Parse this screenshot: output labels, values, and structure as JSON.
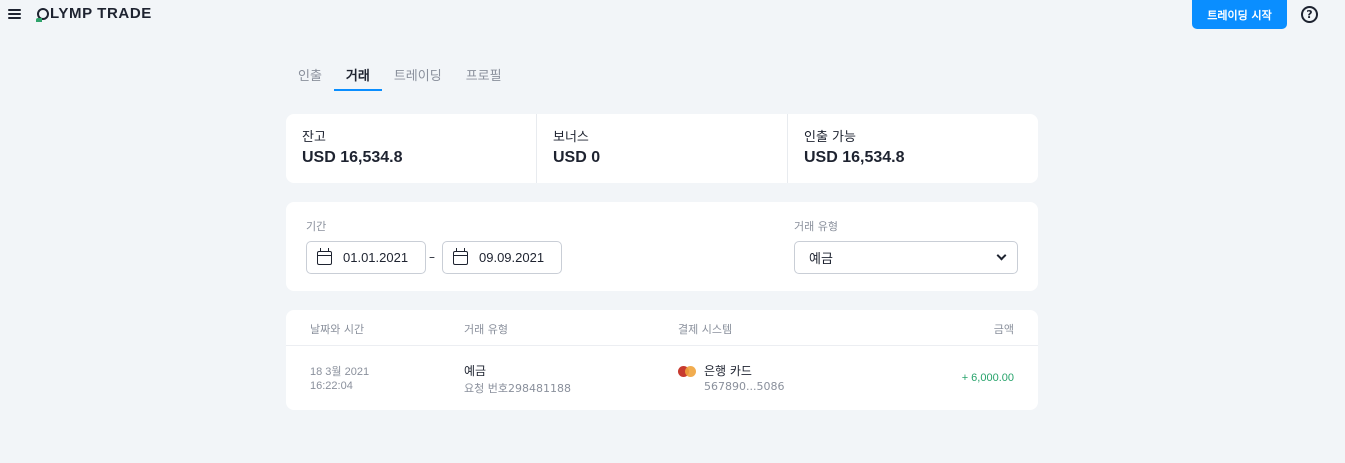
{
  "header": {
    "logo_text": "LYMP TRADE",
    "logo_first_letter": "O",
    "start_button": "트레이딩 시작",
    "help_label": "?"
  },
  "tabs": [
    {
      "label": "인출",
      "active": false
    },
    {
      "label": "거래",
      "active": true
    },
    {
      "label": "트레이딩",
      "active": false
    },
    {
      "label": "프로필",
      "active": false
    }
  ],
  "balances": [
    {
      "label": "잔고",
      "value": "USD 16,534.8"
    },
    {
      "label": "보너스",
      "value": "USD 0"
    },
    {
      "label": "인출 가능",
      "value": "USD 16,534.8"
    }
  ],
  "filters": {
    "period_label": "기간",
    "date_from": "01.01.2021",
    "date_separator": "–",
    "date_to": "09.09.2021",
    "type_label": "거래 유형",
    "type_value": "예금"
  },
  "table": {
    "columns": [
      "날짜와 시간",
      "거래 유형",
      "결제 시스템",
      "금액"
    ],
    "rows": [
      {
        "date": "18 3월 2021",
        "time": "16:22:04",
        "type": "예금",
        "request": "요청 번호298481188",
        "system": "은행 카드",
        "card": "567890...5086",
        "amount": "+ 6,000.00"
      }
    ]
  },
  "colors": {
    "accent": "#0a8eff",
    "background": "#f2f5f8",
    "positive": "#27a36b"
  }
}
